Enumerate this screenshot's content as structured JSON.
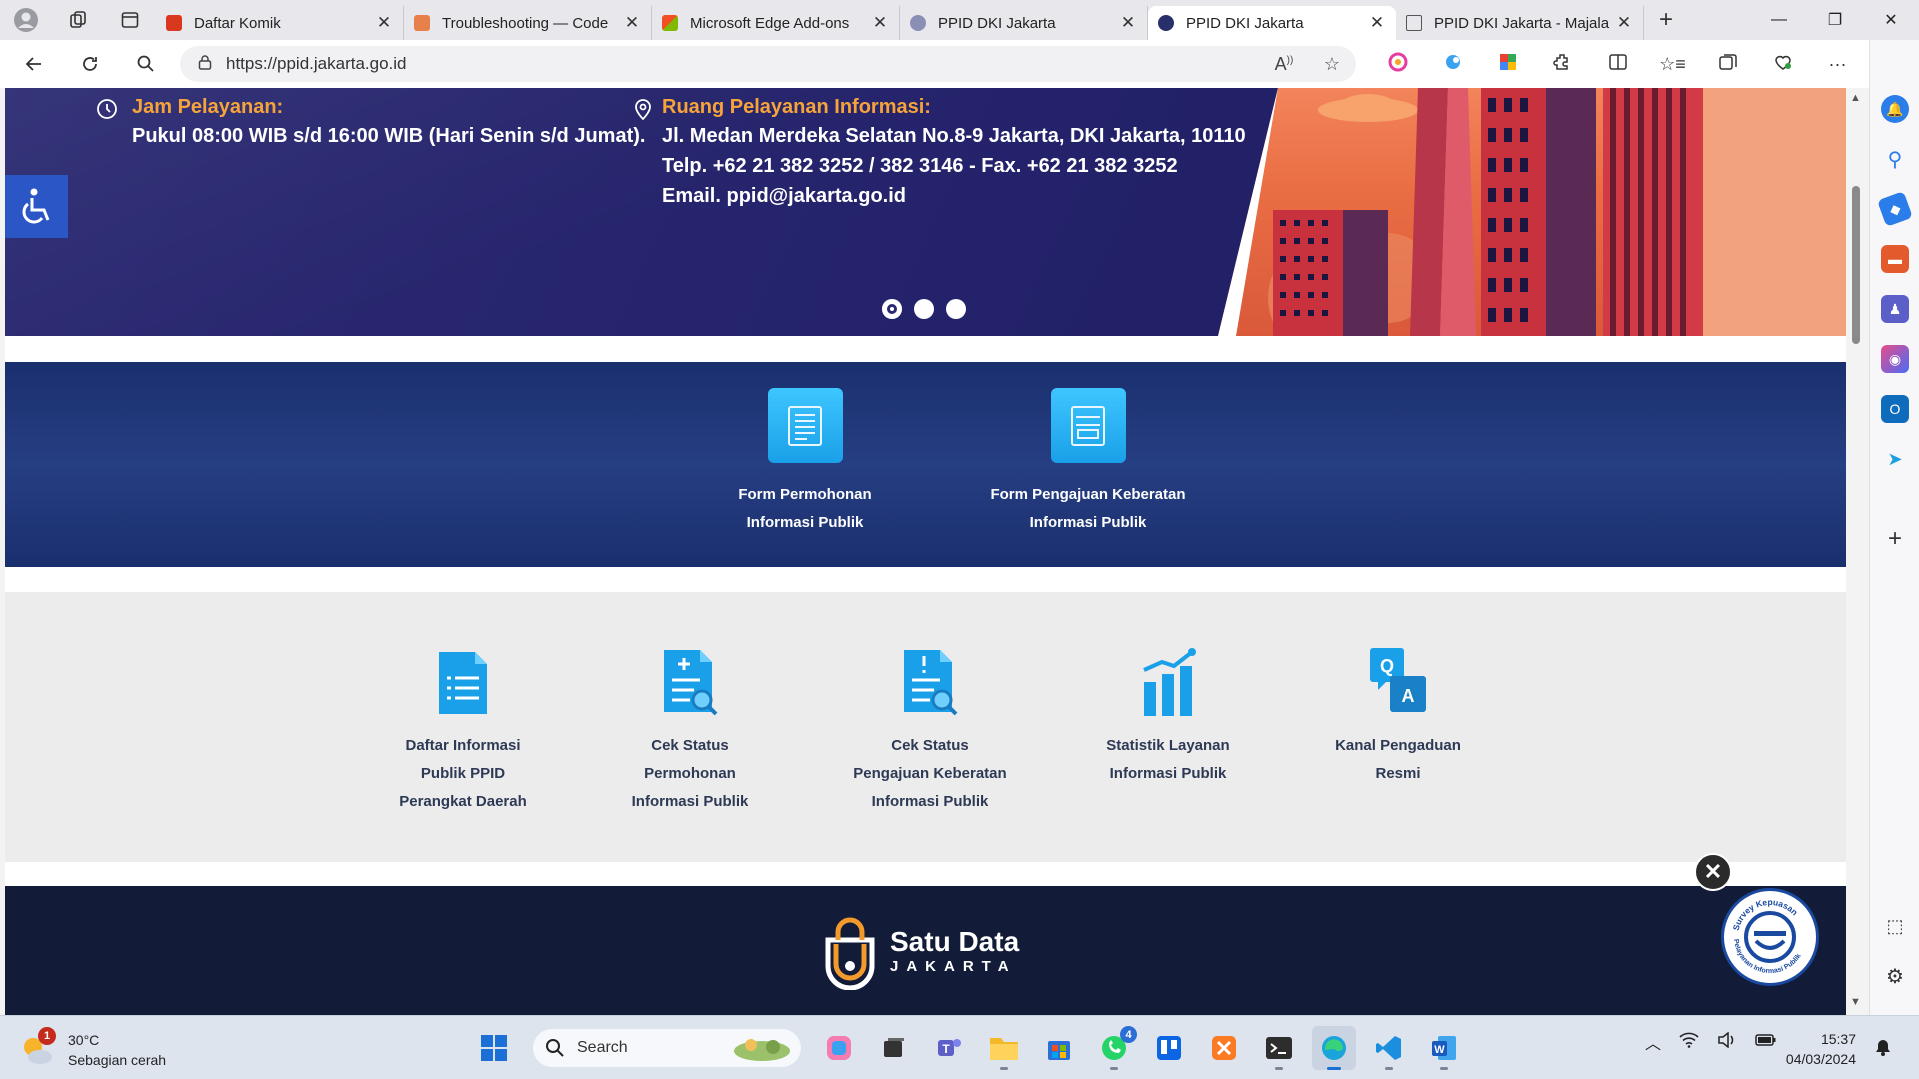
{
  "browser": {
    "tabs": [
      {
        "title": "Daftar Komik",
        "favicon_color": "#d9381e"
      },
      {
        "title": "Troubleshooting — Code",
        "favicon_color": "#e8804b"
      },
      {
        "title": "Microsoft Edge Add-ons",
        "favicon_color": "#4a8ef0"
      },
      {
        "title": "PPID DKI Jakarta",
        "favicon_color": "#8a8fb5"
      },
      {
        "title": "PPID DKI Jakarta",
        "favicon_color": "#27306b",
        "active": true
      },
      {
        "title": "PPID DKI Jakarta - Majala",
        "favicon_color": "#666666"
      }
    ],
    "url": "https://ppid.jakarta.go.id"
  },
  "hero": {
    "hours": {
      "heading": "Jam Pelayanan:",
      "line1": "Pukul 08:00 WIB s/d 16:00 WIB (Hari Senin s/d Jumat)."
    },
    "room": {
      "heading": "Ruang Pelayanan Informasi:",
      "line1": "Jl. Medan Merdeka Selatan No.8-9 Jakarta, DKI Jakarta, 10110",
      "line2": "Telp. +62 21 382 3252 / 382 3146 - Fax. +62 21 382 3252",
      "line3": "Email. ppid@jakarta.go.id"
    },
    "slide_count": 3,
    "active_slide": 1
  },
  "forms": [
    {
      "line1": "Form Permohonan",
      "line2": "Informasi Publik"
    },
    {
      "line1": "Form Pengajuan Keberatan",
      "line2": "Informasi Publik"
    }
  ],
  "services": [
    {
      "lines": [
        "Daftar Informasi",
        "Publik PPID",
        "Perangkat Daerah"
      ],
      "icon": "document-list-icon"
    },
    {
      "lines": [
        "Cek Status",
        "Permohonan",
        "Informasi Publik"
      ],
      "icon": "document-search-icon"
    },
    {
      "lines": [
        "Cek Status",
        "Pengajuan Keberatan",
        "Informasi Publik"
      ],
      "icon": "document-alert-icon"
    },
    {
      "lines": [
        "Statistik Layanan",
        "Informasi Publik"
      ],
      "icon": "bar-chart-icon"
    },
    {
      "lines": [
        "Kanal Pengaduan",
        "Resmi"
      ],
      "icon": "qa-chat-icon"
    }
  ],
  "qa_icon": {
    "q": "Q",
    "a": "A"
  },
  "footer": {
    "logo_title": "Satu Data",
    "logo_subtitle": "JAKARTA"
  },
  "survey_badge": {
    "text_top": "Survey Kepuasan",
    "text_bottom": "Pelayanan Informasi Publik"
  },
  "taskbar": {
    "weather_temp": "30°C",
    "weather_desc": "Sebagian cerah",
    "weather_badge": "1",
    "search_placeholder": "Search",
    "whatsapp_badge": "4",
    "time": "15:37",
    "date": "04/03/2024"
  },
  "colors": {
    "hero_bg": "#2b2a72",
    "hero_accent": "#f6a33a",
    "forms_bg": "#1a2f6e",
    "icon_blue": "#1aa0e8",
    "service_text": "#2e3a55",
    "footer_bg": "#121b38"
  }
}
